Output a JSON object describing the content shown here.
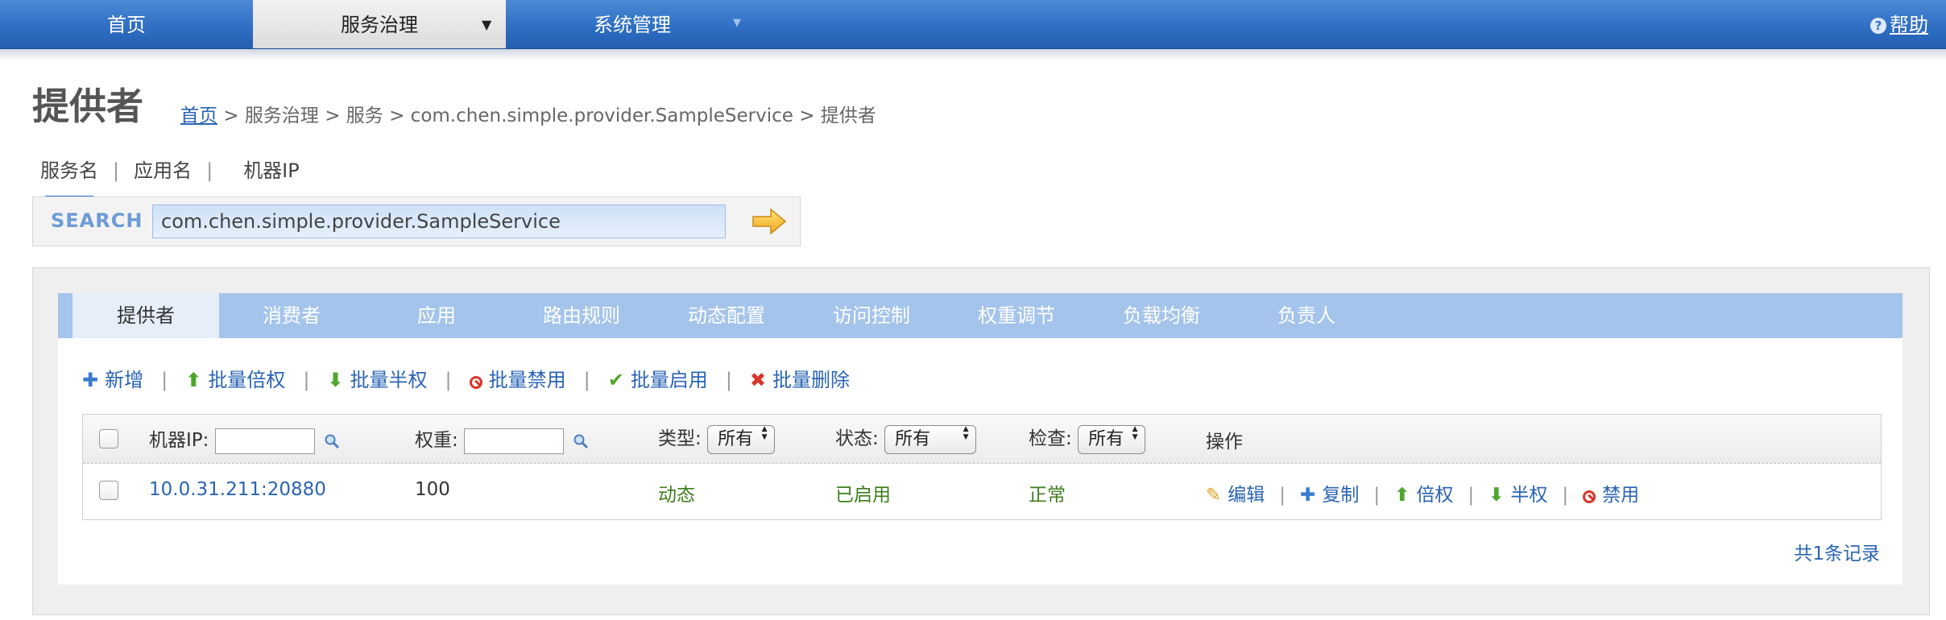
{
  "topnav": {
    "items": [
      {
        "label": "首页"
      },
      {
        "label": "服务治理"
      },
      {
        "label": "系统管理"
      }
    ],
    "help": "帮助"
  },
  "page": {
    "title": "提供者",
    "breadcrumb": {
      "home": "首页",
      "rest": "> 服务治理 > 服务 > com.chen.simple.provider.SampleService > 提供者"
    }
  },
  "search": {
    "types": [
      "服务名",
      "应用名",
      "机器IP"
    ],
    "active_type": "服务名",
    "label": "SEARCH",
    "value": "com.chen.simple.provider.SampleService"
  },
  "tabs": [
    "提供者",
    "消费者",
    "应用",
    "路由规则",
    "动态配置",
    "访问控制",
    "权重调节",
    "负载均衡",
    "负责人"
  ],
  "toolbar": {
    "add": "新增",
    "double": "批量倍权",
    "half": "批量半权",
    "disable": "批量禁用",
    "enable": "批量启用",
    "delete": "批量删除"
  },
  "table": {
    "headers": {
      "ip": "机器IP:",
      "weight": "权重:",
      "type": "类型:",
      "type_filter": "所有",
      "status": "状态:",
      "status_filter": "所有",
      "check": "检查:",
      "check_filter": "所有",
      "ops": "操作"
    },
    "rows": [
      {
        "ip": "10.0.31.211:20880",
        "weight": "100",
        "type": "动态",
        "status": "已启用",
        "check": "正常",
        "ops": {
          "edit": "编辑",
          "copy": "复制",
          "double": "倍权",
          "half": "半权",
          "disable": "禁用"
        }
      }
    ]
  },
  "footer": {
    "total": "共1条记录"
  },
  "colors": {
    "nav": "#2f6fc4",
    "tabbar": "#a5c4ec",
    "link": "#2a64b5",
    "green": "#3d7f1c"
  }
}
